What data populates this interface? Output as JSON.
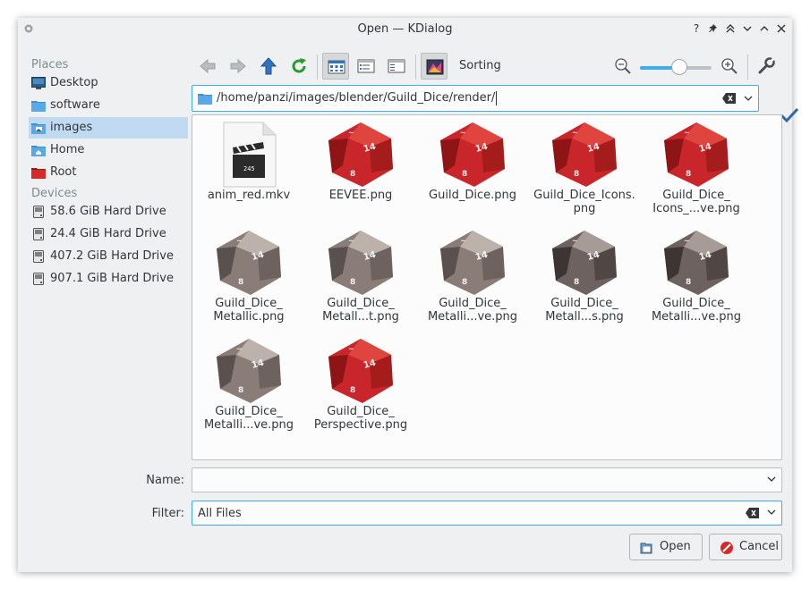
{
  "window": {
    "title": "Open — KDialog"
  },
  "titlebar_buttons": [
    "help",
    "pin",
    "keep-above",
    "minimize",
    "maximize",
    "close"
  ],
  "places": {
    "heading": "Places",
    "items": [
      {
        "label": "Desktop",
        "icon": "desktop-icon"
      },
      {
        "label": "software",
        "icon": "folder-icon"
      },
      {
        "label": "images",
        "icon": "image-folder-icon",
        "selected": true
      },
      {
        "label": "Home",
        "icon": "home-folder-icon"
      },
      {
        "label": "Root",
        "icon": "root-folder-icon"
      }
    ]
  },
  "devices": {
    "heading": "Devices",
    "items": [
      {
        "label": "58.6 GiB Hard Drive"
      },
      {
        "label": "24.4 GiB Hard Drive"
      },
      {
        "label": "407.2 GiB Hard Drive"
      },
      {
        "label": "907.1 GiB Hard Drive"
      }
    ]
  },
  "toolbar": {
    "sorting_label": "Sorting",
    "zoom_level": 0.55
  },
  "path": {
    "value": "/home/panzi/images/blender/Guild_Dice/render/"
  },
  "files": [
    {
      "name": "anim_red.mkv",
      "thumb": "video",
      "label_lines": [
        "anim_red.mkv"
      ]
    },
    {
      "name": "EEVEE.png",
      "thumb": "red",
      "label_lines": [
        "EEVEE.png"
      ]
    },
    {
      "name": "Guild_Dice.png",
      "thumb": "red",
      "label_lines": [
        "Guild_Dice.png"
      ]
    },
    {
      "name": "Guild_Dice_Icons.png",
      "thumb": "red",
      "label_lines": [
        "Guild_Dice_Icons.",
        "png"
      ]
    },
    {
      "name": "Guild_Dice_Icons_...ve.png",
      "thumb": "red",
      "label_lines": [
        "Guild_Dice_",
        "Icons_...ve.png"
      ]
    },
    {
      "name": "Guild_Dice_Metallic.png",
      "thumb": "metal",
      "label_lines": [
        "Guild_Dice_",
        "Metallic.png"
      ]
    },
    {
      "name": "Guild_Dice_Metall...t.png",
      "thumb": "metal",
      "label_lines": [
        "Guild_Dice_",
        "Metall...t.png"
      ]
    },
    {
      "name": "Guild_Dice_Metalli...ve.png",
      "thumb": "metal",
      "label_lines": [
        "Guild_Dice_",
        "Metalli...ve.png"
      ]
    },
    {
      "name": "Guild_Dice_Metall...s.png",
      "thumb": "metal-dark",
      "label_lines": [
        "Guild_Dice_",
        "Metall...s.png"
      ]
    },
    {
      "name": "Guild_Dice_Metalli...ve.png (2)",
      "thumb": "metal-dark",
      "label_lines": [
        "Guild_Dice_",
        "Metalli...ve.png"
      ]
    },
    {
      "name": "Guild_Dice_Metalli...ve.png (3)",
      "thumb": "metal",
      "label_lines": [
        "Guild_Dice_",
        "Metalli...ve.png"
      ]
    },
    {
      "name": "Guild_Dice_Perspective.png",
      "thumb": "red",
      "label_lines": [
        "Guild_Dice_",
        "Perspective.png"
      ]
    }
  ],
  "name_field": {
    "label": "Name:",
    "value": ""
  },
  "filter_field": {
    "label": "Filter:",
    "value": "All Files"
  },
  "buttons": {
    "open": "Open",
    "cancel": "Cancel"
  },
  "colors": {
    "accent": "#3daee9",
    "selection": "#c0dbf1",
    "red_die": "#c8262a",
    "metal_die": "#8a7d78"
  }
}
